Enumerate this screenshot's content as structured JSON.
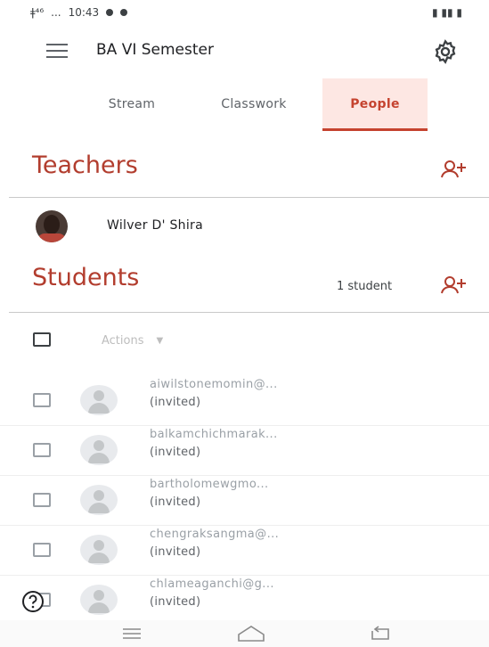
{
  "status_bar": {
    "time": "10:43",
    "signal_left": "ǂ⁴⁶",
    "network": "...",
    "right_indicators": "▮ ▮▮ ▮"
  },
  "app": {
    "title": "BA VI Semester"
  },
  "tabs": [
    {
      "label": "Stream",
      "active": false
    },
    {
      "label": "Classwork",
      "active": false
    },
    {
      "label": "People",
      "active": true
    }
  ],
  "teachers": {
    "title": "Teachers",
    "list": [
      {
        "name": "Wilver D' Shira"
      }
    ]
  },
  "students": {
    "title": "Students",
    "count_label": "1 student",
    "actions_label": "Actions",
    "list": [
      {
        "email": "aiwilstonemomin@...",
        "status": "(invited)"
      },
      {
        "email": "balkamchichmarak...",
        "status": "(invited)"
      },
      {
        "email": "bartholomewgmo...",
        "status": "(invited)"
      },
      {
        "email": "chengraksangma@...",
        "status": "(invited)"
      },
      {
        "email": "chlameaganchi@g...",
        "status": "(invited)"
      }
    ]
  },
  "colors": {
    "accent": "#c5432f",
    "section_title": "#b23d2e",
    "active_tab_bg": "#fde7e3"
  }
}
